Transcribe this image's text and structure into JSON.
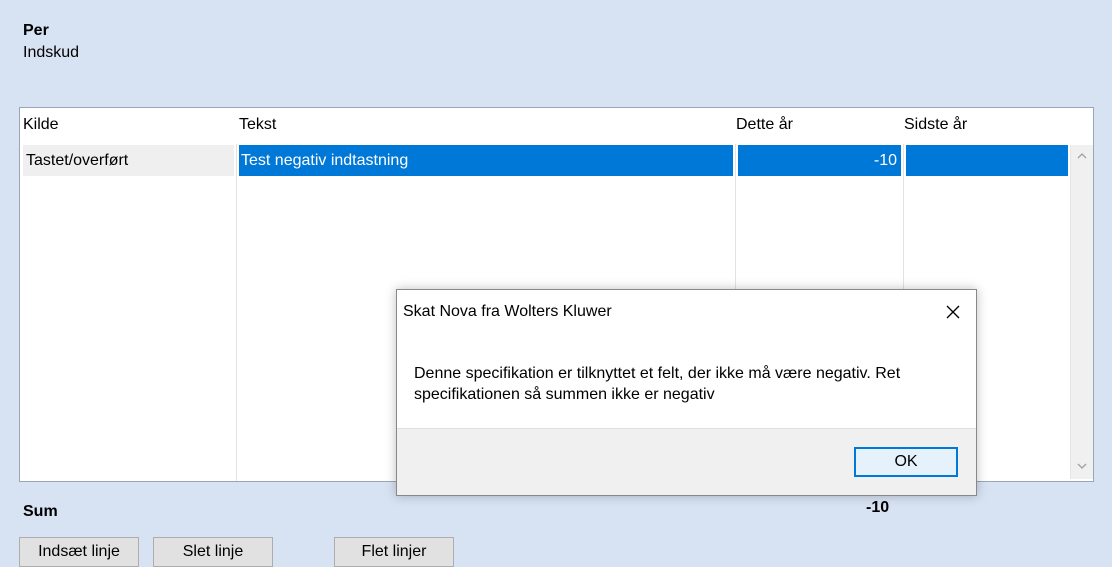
{
  "header": {
    "person_name": "Per",
    "subtitle": "Indskud"
  },
  "grid": {
    "columns": [
      "Kilde",
      "Tekst",
      "Dette år",
      "Sidste år"
    ],
    "rows": [
      {
        "kilde": "Tastet/overført",
        "tekst": "Test negativ indtastning",
        "dette_aar": "-10",
        "sidste_aar": ""
      }
    ]
  },
  "sum": {
    "label": "Sum",
    "value": "-10"
  },
  "buttons": {
    "insert": "Indsæt linje",
    "delete": "Slet linje",
    "merge": "Flet linjer"
  },
  "dialog": {
    "title": "Skat Nova fra Wolters Kluwer",
    "message": "Denne specifikation er tilknyttet et felt, der ikke må være negativ. Ret specifikationen så summen ikke er negativ",
    "ok_label": "OK"
  },
  "colors": {
    "background": "#d7e2f3",
    "selection": "#0078d7"
  }
}
